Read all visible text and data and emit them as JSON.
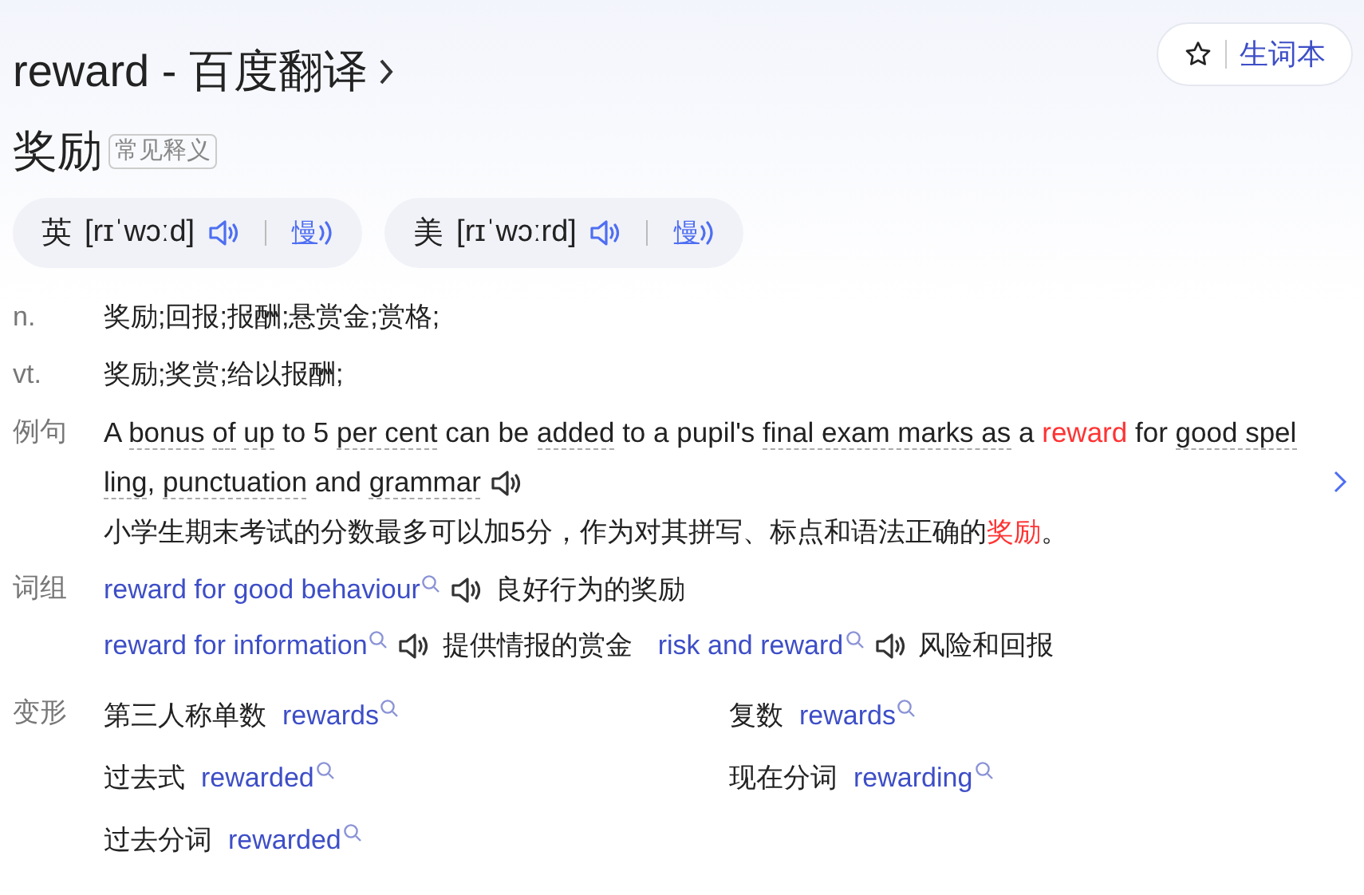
{
  "header": {
    "title": "reward - 百度翻译",
    "wordbook_button": "生词本"
  },
  "headword": {
    "word": "奖励",
    "tag": "常见释义"
  },
  "pronunciations": [
    {
      "region": "英",
      "phonetic": "[rɪˈwɔːd]",
      "slow_label": "慢"
    },
    {
      "region": "美",
      "phonetic": "[rɪˈwɔːrd]",
      "slow_label": "慢"
    }
  ],
  "definitions": [
    {
      "pos": "n.",
      "meaning": "奖励;回报;报酬;悬赏金;赏格;"
    },
    {
      "pos": "vt.",
      "meaning": "奖励;奖赏;给以报酬;"
    }
  ],
  "example": {
    "label": "例句",
    "sentence": [
      {
        "text": "A ",
        "kind": "plain"
      },
      {
        "text": "bonus",
        "kind": "underlined",
        "space_after": true
      },
      {
        "text": "of",
        "kind": "underlined",
        "space_after": true
      },
      {
        "text": "up",
        "kind": "underlined"
      },
      {
        "text": " to 5 ",
        "kind": "plain"
      },
      {
        "text": "per cent",
        "kind": "underlined"
      },
      {
        "text": " can be ",
        "kind": "plain"
      },
      {
        "text": "added",
        "kind": "underlined"
      },
      {
        "text": " to a pupil's ",
        "kind": "plain"
      },
      {
        "text": "final exam marks as",
        "kind": "underlined"
      },
      {
        "text": " a ",
        "kind": "plain"
      },
      {
        "text": "reward",
        "kind": "highlight"
      },
      {
        "text": " for ",
        "kind": "plain"
      },
      {
        "text": "good spelling",
        "kind": "underlined"
      },
      {
        "text": ", ",
        "kind": "plain"
      },
      {
        "text": "punctuation",
        "kind": "underlined"
      },
      {
        "text": " and ",
        "kind": "plain"
      },
      {
        "text": "grammar",
        "kind": "underlined"
      }
    ],
    "translation": [
      {
        "text": "小学生期末考试的分数最多可以加5分，作为对其拼写、标点和语法正确的",
        "kind": "plain"
      },
      {
        "text": "奖励",
        "kind": "highlight"
      },
      {
        "text": "。",
        "kind": "plain"
      }
    ]
  },
  "phrases": {
    "label": "词组",
    "rows": [
      {
        "items": [
          {
            "phrase": "reward for good behaviour",
            "meaning": "良好行为的奖励"
          }
        ]
      },
      {
        "items": [
          {
            "phrase": "reward for information",
            "meaning": "提供情报的赏金"
          },
          {
            "phrase": "risk and reward",
            "meaning": "风险和回报"
          }
        ]
      }
    ]
  },
  "forms": {
    "label": "变形",
    "items": [
      {
        "name": "第三人称单数",
        "word": "rewards"
      },
      {
        "name": "复数",
        "word": "rewards"
      },
      {
        "name": "过去式",
        "word": "rewarded"
      },
      {
        "name": "现在分词",
        "word": "rewarding"
      },
      {
        "name": "过去分词",
        "word": "rewarded"
      }
    ]
  }
}
